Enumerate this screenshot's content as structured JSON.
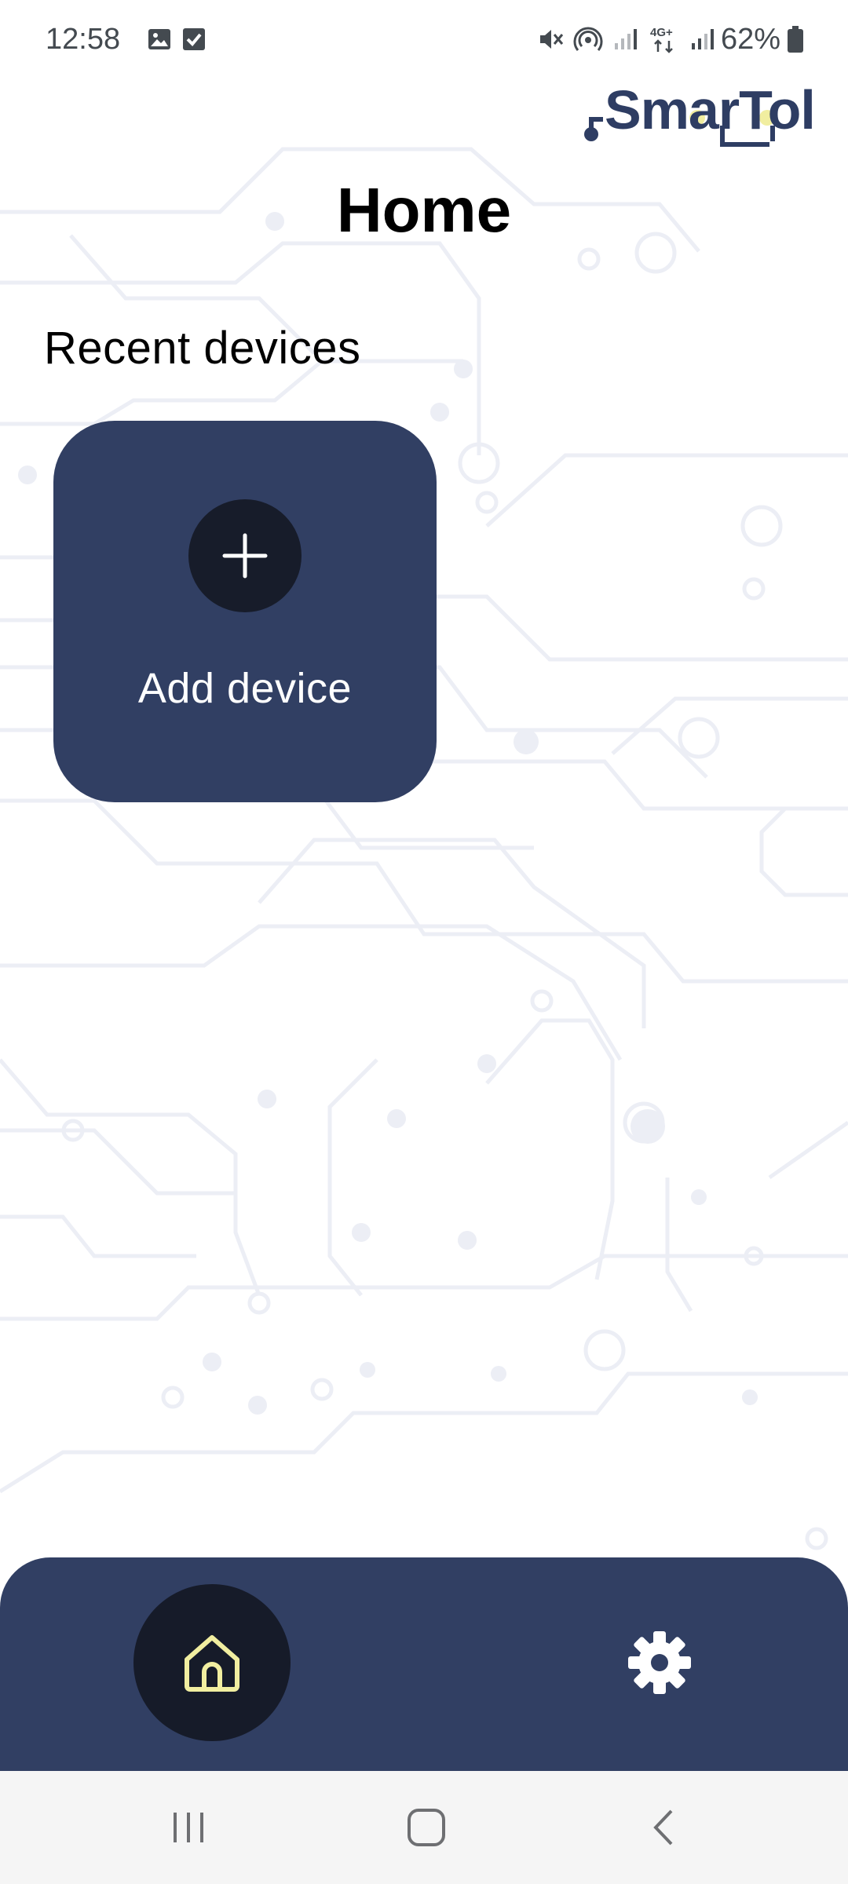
{
  "status_bar": {
    "time": "12:58",
    "battery_pct": "62%",
    "network_label": "4G+",
    "icons": [
      "gallery-icon",
      "check-box-icon",
      "mute-icon",
      "hotspot-icon",
      "signal-icon",
      "network-4g-icon",
      "signal-icon",
      "battery-icon"
    ]
  },
  "logo": {
    "text": "SmarTol"
  },
  "page": {
    "title": "Home"
  },
  "recent": {
    "title": "Recent devices",
    "add_label": "Add device"
  },
  "bottom_nav": {
    "items": [
      {
        "icon": "home-icon",
        "active": true
      },
      {
        "icon": "gear-icon",
        "active": false
      }
    ]
  },
  "colors": {
    "primary": "#313f63",
    "dark": "#161b29",
    "accent": "#f1eea0",
    "system_nav_bg": "#f5f5f5"
  },
  "system_nav": {
    "icons": [
      "recents-icon",
      "home-button-icon",
      "back-icon"
    ]
  }
}
